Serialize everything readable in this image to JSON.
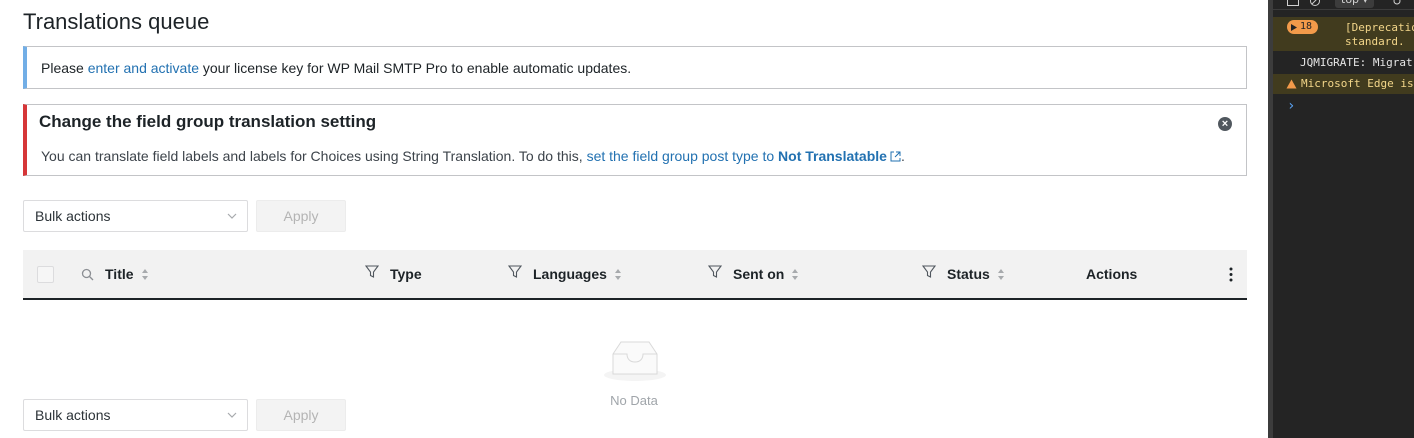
{
  "page": {
    "title": "Translations queue"
  },
  "license_notice": {
    "before": "Please ",
    "link": "enter and activate",
    "after": " your license key for WP Mail SMTP Pro to enable automatic updates."
  },
  "field_group_notice": {
    "heading": "Change the field group translation setting",
    "text": "You can translate field labels and labels for Choices using String Translation. To do this, ",
    "link_text": "set the field group post type to ",
    "link_bold": "Not Translatable",
    "end": ".",
    "dismiss_icon": "close-circle-icon"
  },
  "bulk_top": {
    "label": "Bulk actions",
    "apply": "Apply"
  },
  "bulk_bottom": {
    "label": "Bulk actions",
    "apply": "Apply"
  },
  "table": {
    "columns": {
      "title": "Title",
      "type": "Type",
      "languages": "Languages",
      "sent_on": "Sent on",
      "status": "Status",
      "actions": "Actions"
    },
    "empty_text": "No Data"
  },
  "devtools": {
    "context": "top",
    "count": "18",
    "deprecation_line1": "[Deprecatio",
    "deprecation_line2": "standard.",
    "jqmigrate": "JQMIGRATE: Migrat",
    "edge_warning": "Microsoft Edge is",
    "prompt": "›"
  },
  "colors": {
    "info_border": "#72aee6",
    "error_border": "#d63638",
    "link": "#2271b1",
    "devtools_bg": "#242424",
    "warning_bg": "#413b1e"
  }
}
